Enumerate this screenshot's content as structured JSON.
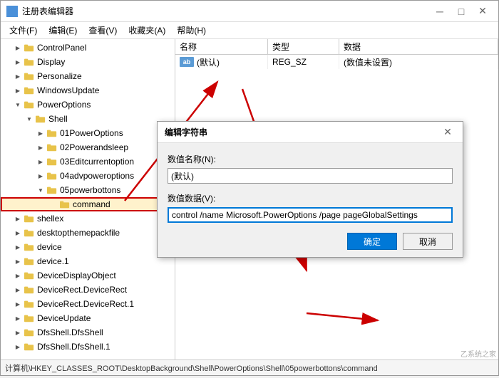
{
  "window": {
    "title": "注册表编辑器",
    "icon_label": "R"
  },
  "menu": {
    "items": [
      "文件(F)",
      "编辑(E)",
      "查看(V)",
      "收藏夹(A)",
      "帮助(H)"
    ]
  },
  "tree": {
    "items": [
      {
        "label": "ControlPanel",
        "indent": 1,
        "expanded": false,
        "selected": false
      },
      {
        "label": "Display",
        "indent": 1,
        "expanded": false,
        "selected": false
      },
      {
        "label": "Personalize",
        "indent": 1,
        "expanded": false,
        "selected": false
      },
      {
        "label": "WindowsUpdate",
        "indent": 1,
        "expanded": false,
        "selected": false
      },
      {
        "label": "PowerOptions",
        "indent": 1,
        "expanded": true,
        "selected": false
      },
      {
        "label": "Shell",
        "indent": 2,
        "expanded": true,
        "selected": false
      },
      {
        "label": "01PowerOptions",
        "indent": 3,
        "expanded": false,
        "selected": false
      },
      {
        "label": "02Powerandsleep",
        "indent": 3,
        "expanded": false,
        "selected": false
      },
      {
        "label": "03Editcurrentoption",
        "indent": 3,
        "expanded": false,
        "selected": false
      },
      {
        "label": "04advpoweroptions",
        "indent": 3,
        "expanded": false,
        "selected": false
      },
      {
        "label": "05powerbottons",
        "indent": 3,
        "expanded": true,
        "selected": false
      },
      {
        "label": "command",
        "indent": 4,
        "expanded": false,
        "selected": true,
        "highlighted": true
      },
      {
        "label": "shellex",
        "indent": 1,
        "expanded": false,
        "selected": false
      },
      {
        "label": "desktopthemepackfile",
        "indent": 1,
        "expanded": false,
        "selected": false
      },
      {
        "label": "device",
        "indent": 1,
        "expanded": false,
        "selected": false
      },
      {
        "label": "device.1",
        "indent": 1,
        "expanded": false,
        "selected": false
      },
      {
        "label": "DeviceDisplayObject",
        "indent": 1,
        "expanded": false,
        "selected": false
      },
      {
        "label": "DeviceRect.DeviceRect",
        "indent": 1,
        "expanded": false,
        "selected": false
      },
      {
        "label": "DeviceRect.DeviceRect.1",
        "indent": 1,
        "expanded": false,
        "selected": false
      },
      {
        "label": "DeviceUpdate",
        "indent": 1,
        "expanded": false,
        "selected": false
      },
      {
        "label": "DfsShell.DfsShell",
        "indent": 1,
        "expanded": false,
        "selected": false
      },
      {
        "label": "DfsShell.DfsShell.1",
        "indent": 1,
        "expanded": false,
        "selected": false
      }
    ]
  },
  "columns": {
    "name": "名称",
    "type": "类型",
    "data": "数据"
  },
  "registry_values": [
    {
      "name": "(默认)",
      "type": "REG_SZ",
      "data": "(数值未设置)",
      "icon": "ab"
    }
  ],
  "status_bar": {
    "text": "计算机\\HKEY_CLASSES_ROOT\\DesktopBackground\\Shell\\PowerOptions\\Shell\\05powerbottons\\command"
  },
  "dialog": {
    "title": "编辑字符串",
    "name_label": "数值名称(N):",
    "name_value": "(默认)",
    "data_label": "数值数据(V):",
    "data_value": "control /name Microsoft.PowerOptions /page pageGlobalSettings",
    "ok_label": "确定",
    "cancel_label": "取消"
  },
  "watermark": {
    "text": "乙系统之家"
  }
}
